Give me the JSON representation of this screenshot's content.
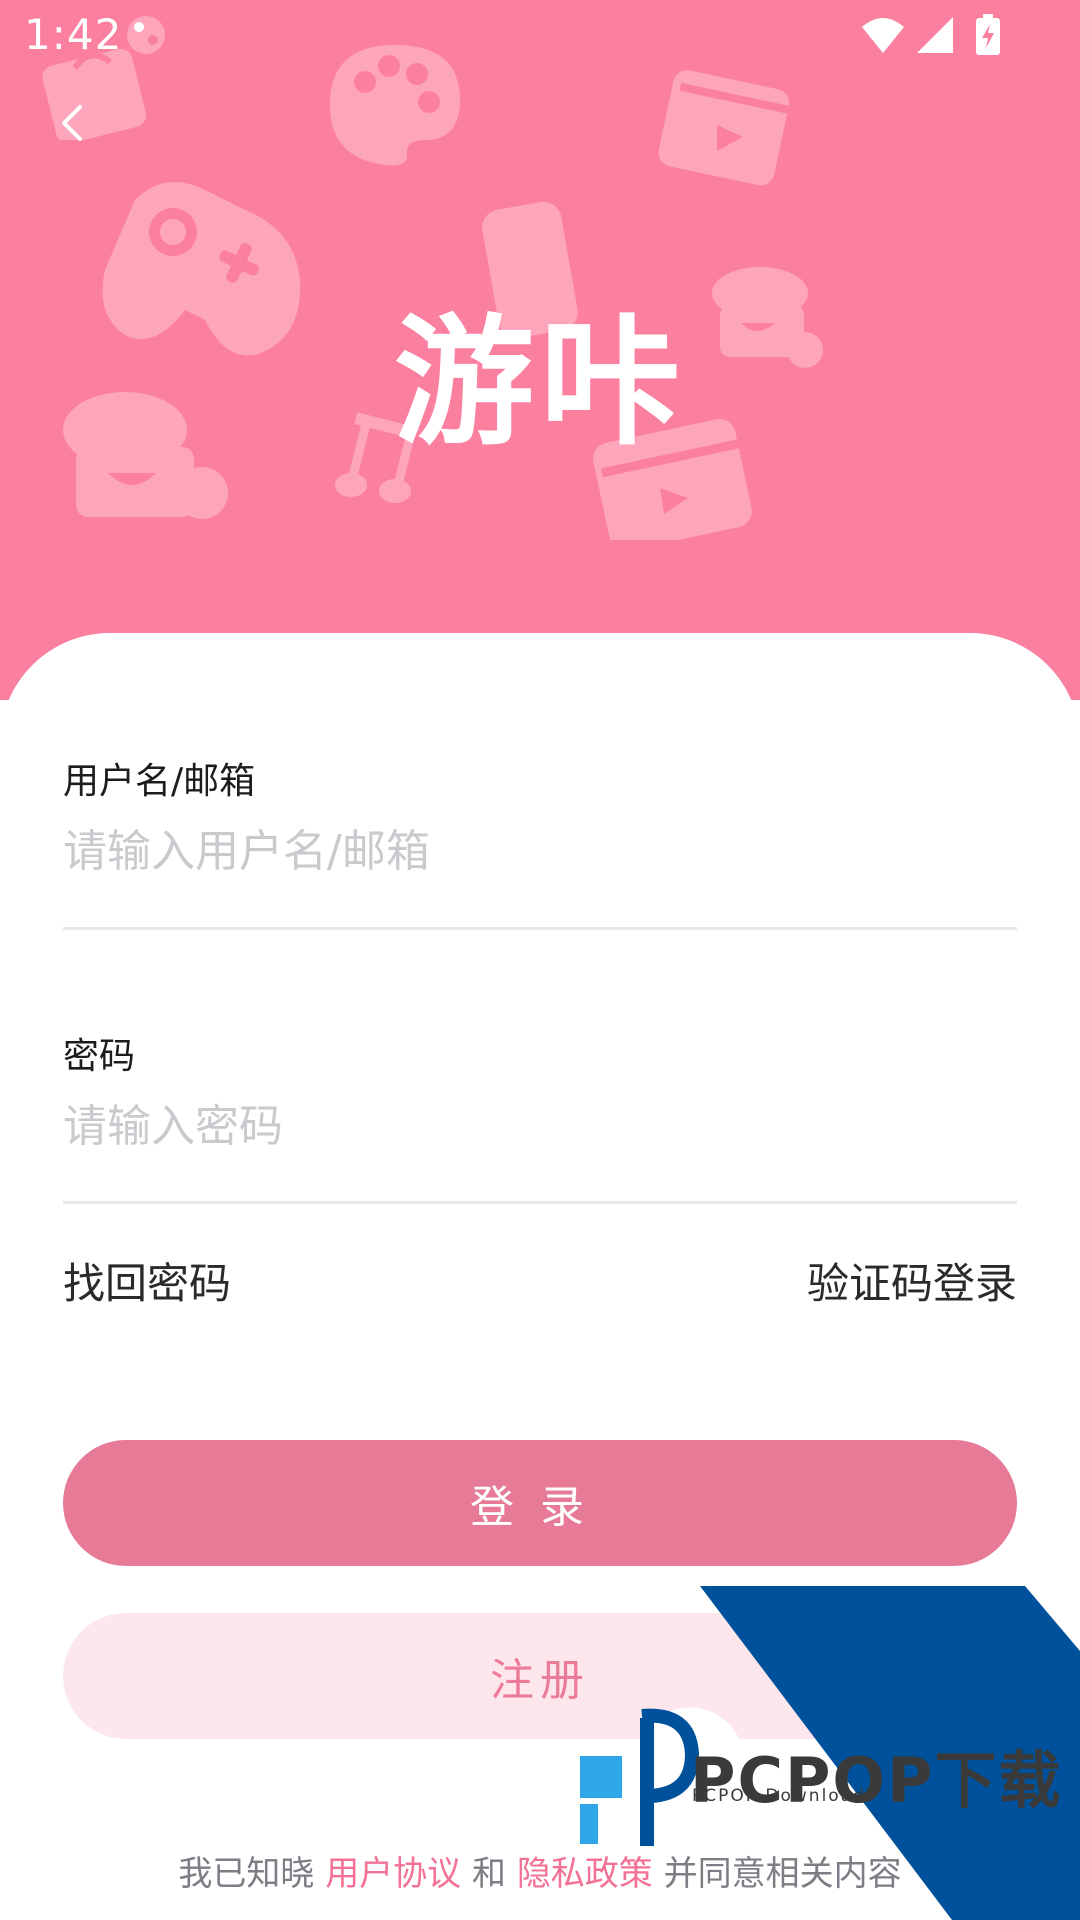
{
  "status_bar": {
    "time": "1:42"
  },
  "header": {
    "app_title": "游咔"
  },
  "form": {
    "username": {
      "label": "用户名/邮箱",
      "placeholder": "请输入用户名/邮箱",
      "value": ""
    },
    "password": {
      "label": "密码",
      "placeholder": "请输入密码",
      "value": ""
    },
    "forgot_password": "找回密码",
    "code_login": "验证码登录",
    "login_button": "登录",
    "register_button": "注册"
  },
  "agreement": {
    "prefix": "我已知晓",
    "user_agreement": "用户协议",
    "and": "和",
    "privacy_policy": "隐私政策",
    "suffix": "并同意相关内容"
  },
  "watermark": {
    "brand": "PCPOP下载",
    "sub": "PCPOP Download"
  },
  "colors": {
    "hero_background": "#fb809f",
    "login_button": "#e67a97",
    "register_button": "#fde7ec",
    "link_pink": "#f37194",
    "watermark_blue": "#00519b"
  },
  "icons": [
    "back-arrow-icon",
    "wifi-icon",
    "cell-signal-icon",
    "battery-charging-icon",
    "notification-icon"
  ]
}
